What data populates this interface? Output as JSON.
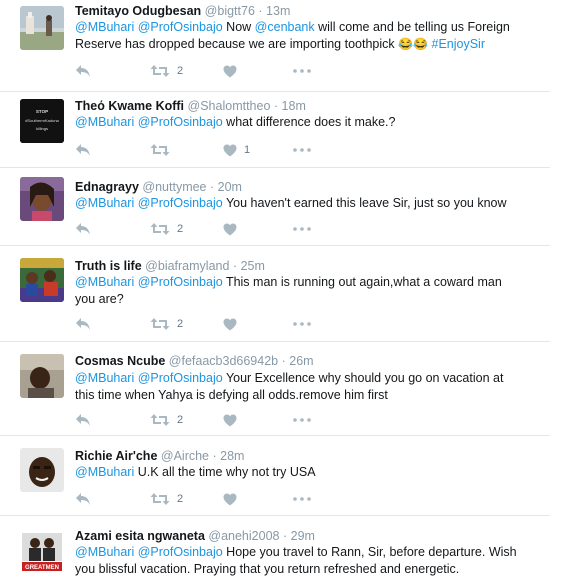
{
  "tweets": [
    {
      "name": "Temitayo Odugbesan",
      "handle": "@bigtt76",
      "time": "13m",
      "mentions": [
        "@MBuhari",
        "@ProfOsinbajo"
      ],
      "text_a": "Now",
      "mention_b": "@cenbank",
      "text_b": "will come and be telling us Foreign Reserve has dropped because we are importing toothpick",
      "emoji": "😂😂",
      "hashtag": "#EnjoySir",
      "retweets": "2",
      "likes": ""
    },
    {
      "name": "Τheό Kwame Koffi",
      "handle": "@Shalomttheo",
      "time": "18m",
      "mentions": [
        "@MBuhari",
        "@ProfOsinbajo"
      ],
      "text": "what difference does it make.?",
      "retweets": "",
      "likes": "1",
      "avatar_text": [
        "STOP",
        "#SoutherrnKaduna",
        "killings"
      ]
    },
    {
      "name": "Ednagrayy",
      "handle": "@nuttymee",
      "time": "20m",
      "mentions": [
        "@MBuhari",
        "@ProfOsinbajo"
      ],
      "text": "You haven't earned this leave Sir, just so you know",
      "retweets": "2",
      "likes": ""
    },
    {
      "name": "Truth is life",
      "handle": "@biaframyland",
      "time": "25m",
      "mentions": [
        "@MBuhari",
        "@ProfOsinbajo"
      ],
      "text": "This man is running out again,what a coward man you are?",
      "retweets": "2",
      "likes": ""
    },
    {
      "name": "Cosmas Ncube",
      "handle": "@fefaacb3d66942b",
      "time": "26m",
      "mentions": [
        "@MBuhari",
        "@ProfOsinbajo"
      ],
      "text": "Your Excellence why should you go on vacation at this time when Yahya is defying all odds.remove him first",
      "retweets": "2",
      "likes": ""
    },
    {
      "name": "Richie Air'che",
      "handle": "@Airche",
      "time": "28m",
      "mentions": [
        "@MBuhari"
      ],
      "text": "U.K all the time why not try USA",
      "retweets": "2",
      "likes": ""
    },
    {
      "name": "Azami esita ngwaneta",
      "handle": "@anehi2008",
      "time": "29m",
      "mentions": [
        "@MBuhari",
        "@ProfOsinbajo"
      ],
      "text": "Hope you travel to Rann, Sir, before departure. Wish you blissful vacation. Praying that you return refreshed and energetic.",
      "retweets": "",
      "likes": "",
      "avatar_text": [
        "GREATMEN"
      ]
    }
  ],
  "separator": "·",
  "icons": {
    "reply": "reply-icon",
    "retweet": "retweet-icon",
    "like": "heart-icon",
    "more": "more-icon"
  },
  "colors": {
    "mention": "#1b95e0",
    "muted": "#8899a6",
    "icon": "#aab8c2",
    "divider": "#e1e8ed"
  }
}
